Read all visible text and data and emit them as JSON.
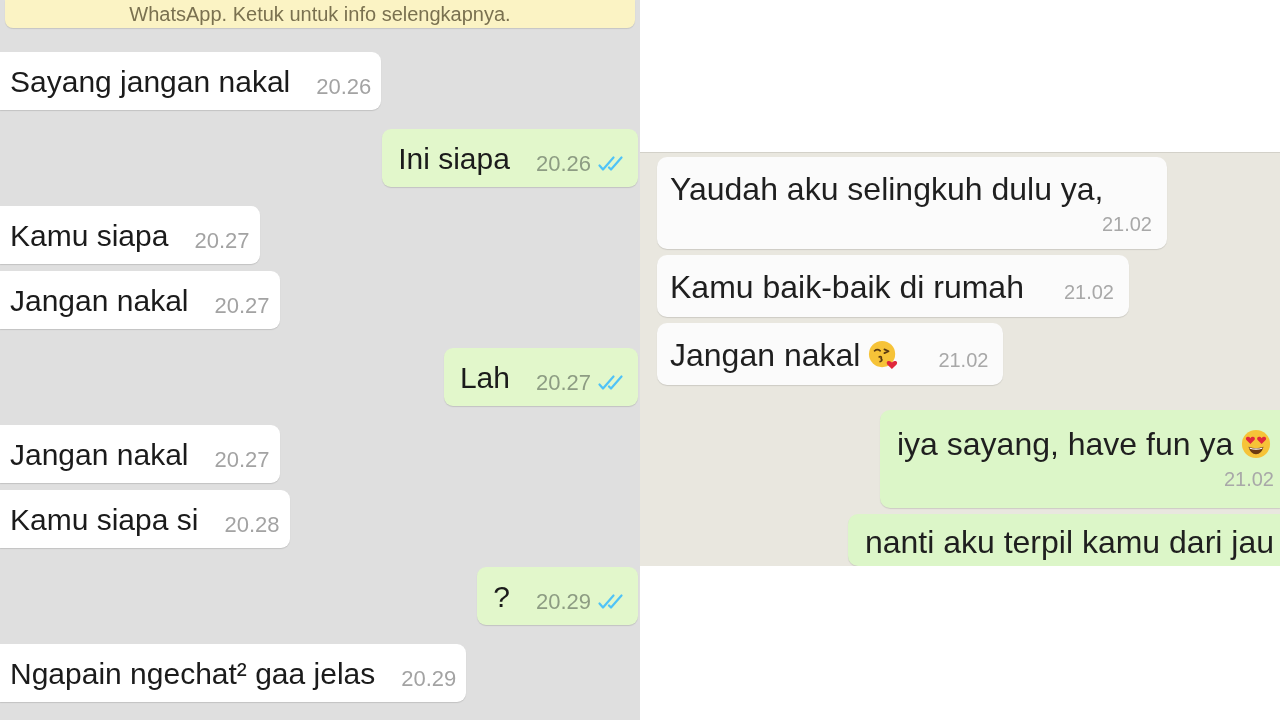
{
  "left_chat": {
    "notice": "WhatsApp. Ketuk untuk info selengkapnya.",
    "messages": [
      {
        "kind": "incoming",
        "text": "Sayang jangan nakal",
        "time": "20.26"
      },
      {
        "kind": "outgoing",
        "text": "Ini siapa",
        "time": "20.26",
        "read": true
      },
      {
        "kind": "incoming",
        "text": "Kamu siapa",
        "time": "20.27"
      },
      {
        "kind": "incoming",
        "text": "Jangan nakal",
        "time": "20.27"
      },
      {
        "kind": "outgoing",
        "text": "Lah",
        "time": "20.27",
        "read": true
      },
      {
        "kind": "incoming",
        "text": "Jangan nakal",
        "time": "20.27"
      },
      {
        "kind": "incoming",
        "text": "Kamu siapa si",
        "time": "20.28"
      },
      {
        "kind": "outgoing",
        "text": "?",
        "time": "20.29",
        "read": true
      },
      {
        "kind": "incoming",
        "text": "Ngapain ngechat² gaa jelas",
        "time": "20.29"
      }
    ]
  },
  "right_chat": {
    "messages": [
      {
        "kind": "incoming",
        "text": "Yaudah aku selingkuh dulu ya,",
        "time": "21.02"
      },
      {
        "kind": "incoming",
        "text": "Kamu baik-baik di rumah",
        "time": "21.02"
      },
      {
        "kind": "incoming",
        "text": "Jangan nakal",
        "emoji": {
          "kind": "kiss"
        },
        "time": "21.02"
      },
      {
        "kind": "outgoing",
        "text": "iya sayang, have fun ya",
        "emoji": {
          "kind": "heart-eyes"
        },
        "time": "21.02"
      },
      {
        "kind": "outgoing",
        "text": "nanti aku terpil kamu dari jau"
      }
    ]
  }
}
